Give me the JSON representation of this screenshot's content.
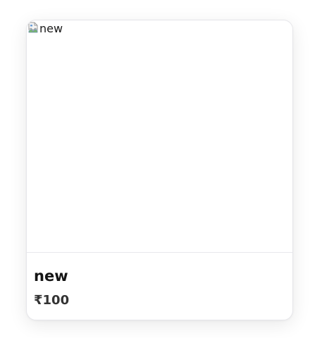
{
  "product": {
    "image_alt": "new",
    "image_icon": "broken-image-icon",
    "title": "new",
    "price": "₹100"
  }
}
